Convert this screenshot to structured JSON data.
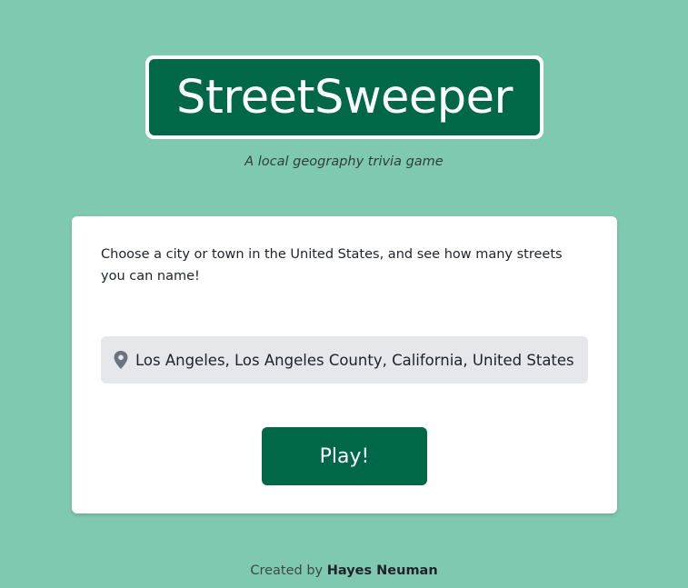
{
  "header": {
    "logo_text": "StreetSweeper",
    "subtitle": "A local geography trivia game"
  },
  "card": {
    "intro": "Choose a city or town in the United States, and see how many streets you can name!",
    "location": {
      "value": "Los Angeles, Los Angeles County, California, United States",
      "icon": "map-pin-icon"
    },
    "play_label": "Play!"
  },
  "footer": {
    "prefix": "Created by ",
    "author": "Hayes Neuman"
  },
  "colors": {
    "background": "#80c9b1",
    "brand_green": "#006847",
    "field_bg": "#e5e7eb"
  }
}
